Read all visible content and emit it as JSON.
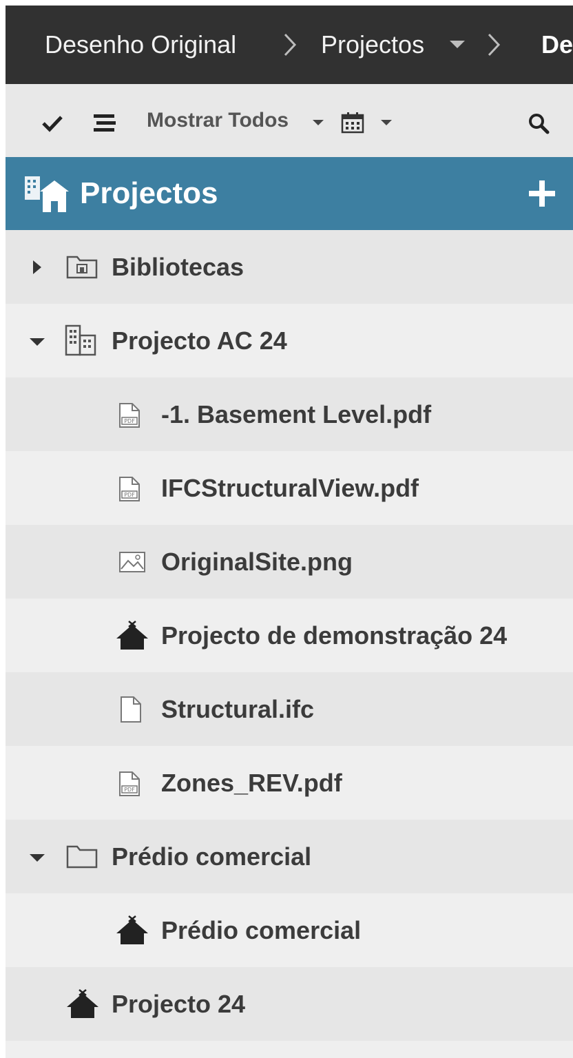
{
  "breadcrumb": {
    "items": [
      {
        "label": "Desenho Original"
      },
      {
        "label": "Projectos",
        "has_dropdown": true
      },
      {
        "label": "De"
      }
    ]
  },
  "toolbar": {
    "filter_label": "Mostrar Todos"
  },
  "header": {
    "title": "Projectos"
  },
  "tree": {
    "items": [
      {
        "label": "Bibliotecas",
        "icon": "library-folder-icon",
        "toggle": "collapsed"
      },
      {
        "label": "Projecto AC 24",
        "icon": "building-icon",
        "toggle": "expanded"
      },
      {
        "label": "-1. Basement Level.pdf",
        "icon": "pdf-file-icon"
      },
      {
        "label": "IFCStructuralView.pdf",
        "icon": "pdf-file-icon"
      },
      {
        "label": "OriginalSite.png",
        "icon": "image-file-icon"
      },
      {
        "label": "Projecto de demonstração 24",
        "icon": "house-icon"
      },
      {
        "label": "Structural.ifc",
        "icon": "file-icon"
      },
      {
        "label": "Zones_REV.pdf",
        "icon": "pdf-file-icon"
      },
      {
        "label": "Prédio comercial",
        "icon": "folder-icon",
        "toggle": "expanded"
      },
      {
        "label": "Prédio comercial",
        "icon": "house-icon"
      },
      {
        "label": "Projecto 24",
        "icon": "house-icon"
      }
    ]
  },
  "colors": {
    "breadcrumb_bg": "#313131",
    "toolbar_bg": "#e8e8e8",
    "header_bg": "#3d7fa1",
    "row_shade": "#e6e6e6",
    "row_light": "#efefef"
  }
}
